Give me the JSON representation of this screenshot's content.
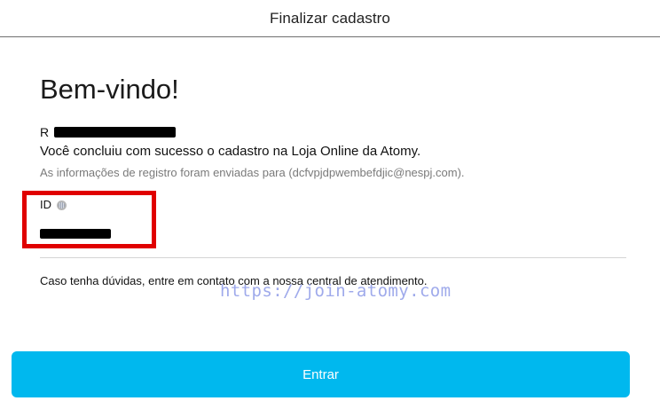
{
  "header": {
    "title": "Finalizar cadastro"
  },
  "main": {
    "welcome": "Bem-vindo!",
    "name_initial": "R",
    "success_message": "Você concluiu com sucesso o cadastro na Loja Online da Atomy.",
    "info_message": "As informações de registro foram enviadas para (dcfvpjdpwembefdjic@nespj.com).",
    "id_label": "ID",
    "help_text": "Caso tenha dúvidas, entre em contato com a nossa central de atendimento."
  },
  "watermark": {
    "text": "https://join-atomy.com"
  },
  "footer": {
    "enter_label": "Entrar"
  },
  "colors": {
    "accent": "#00b8ee",
    "highlight": "#e00000",
    "watermark": "#9aa6ea"
  },
  "icons": {
    "id_info": "info-icon"
  }
}
